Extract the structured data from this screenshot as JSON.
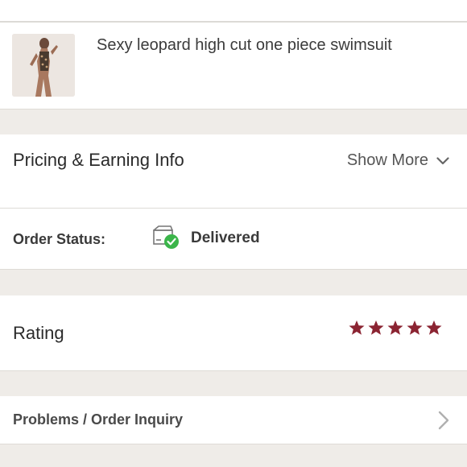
{
  "product": {
    "name": "Sexy leopard high cut one piece swimsuit"
  },
  "pricing": {
    "title": "Pricing & Earning Info",
    "show_more": "Show More"
  },
  "order_status": {
    "label": "Order Status:",
    "value": "Delivered",
    "icon": "box-delivered-icon"
  },
  "rating": {
    "label": "Rating",
    "stars": 5,
    "max_stars": 5,
    "color": "#8b2432"
  },
  "problems": {
    "label": "Problems / Order Inquiry"
  },
  "colors": {
    "background": "#efece8",
    "card": "#ffffff",
    "delivered_check": "#3bb54a",
    "star": "#8b2432"
  }
}
